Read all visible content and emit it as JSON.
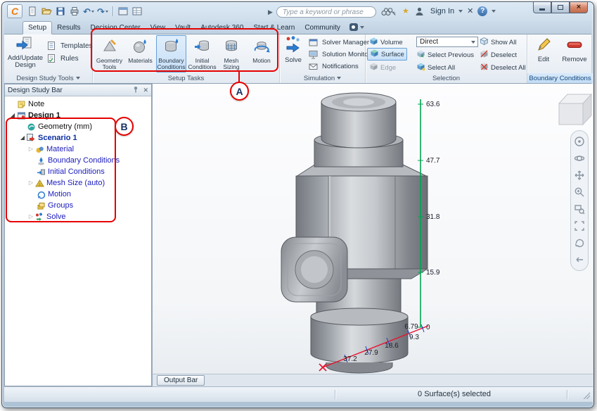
{
  "titlebar": {
    "search_placeholder": "Type a keyword or phrase",
    "sign_in_label": "Sign In"
  },
  "tabs": [
    {
      "label": "Setup"
    },
    {
      "label": "Results"
    },
    {
      "label": "Decision Center"
    },
    {
      "label": "View"
    },
    {
      "label": "Vault"
    },
    {
      "label": "Autodesk 360"
    },
    {
      "label": "Start & Learn"
    },
    {
      "label": "Community"
    }
  ],
  "ribbon": {
    "design_study_tools": {
      "label": "Design Study Tools",
      "add_update_design": "Add/Update Design",
      "templates": "Templates",
      "rules": "Rules"
    },
    "setup_tasks": {
      "label": "Setup Tasks",
      "geometry_tools": "Geometry Tools",
      "materials": "Materials",
      "boundary_conditions": "Boundary Conditions",
      "initial_conditions": "Initial Conditions",
      "mesh_sizing": "Mesh Sizing",
      "motion": "Motion"
    },
    "simulation": {
      "label": "Simulation",
      "solve": "Solve",
      "solver_manager": "Solver Manager",
      "solution_monitor": "Solution Monitor",
      "notifications": "Notifications"
    },
    "selection": {
      "label": "Selection",
      "volume": "Volume",
      "surface": "Surface",
      "edge": "Edge",
      "direct": "Direct",
      "select_previous": "Select Previous",
      "select_all": "Select All",
      "show_all": "Show All",
      "deselect": "Deselect",
      "deselect_all": "Deselect All"
    },
    "boundary_conditions_panel": {
      "label": "Boundary Conditions",
      "edit": "Edit",
      "remove": "Remove"
    }
  },
  "design_study_bar": {
    "title": "Design Study Bar",
    "tree": [
      {
        "label": "Note"
      },
      {
        "label": "Design 1"
      },
      {
        "label": "Geometry (mm)"
      },
      {
        "label": "Scenario 1"
      },
      {
        "label": "Material"
      },
      {
        "label": "Boundary Conditions"
      },
      {
        "label": "Initial Conditions"
      },
      {
        "label": "Mesh Size (auto)"
      },
      {
        "label": "Motion"
      },
      {
        "label": "Groups"
      },
      {
        "label": "Solve"
      }
    ]
  },
  "viewport": {
    "ruler_labels": [
      "63.6",
      "47.7",
      "31.8",
      "15.9",
      "0"
    ],
    "measure_labels": [
      "37.2",
      "27.9",
      "18.6",
      "9.3",
      "6.79"
    ],
    "output_bar_label": "Output Bar"
  },
  "statusbar": {
    "selection_status": "0 Surface(s) selected"
  },
  "annotations": {
    "a": "A",
    "b": "B"
  },
  "colors": {
    "annotation_red": "#e60000",
    "selection_highlight": "#c6dff7",
    "ruler_green": "#00a651",
    "measure_red": "#e8112d",
    "measure_blue": "#2038c8",
    "brand_orange": "#ef7b0e"
  },
  "icons": {
    "app_logo": "orange-C-swoosh",
    "search": "binoculars",
    "sign_in": "person-silhouette",
    "help": "question-circle",
    "panel_pin": "pushpin",
    "panel_close": "x"
  }
}
